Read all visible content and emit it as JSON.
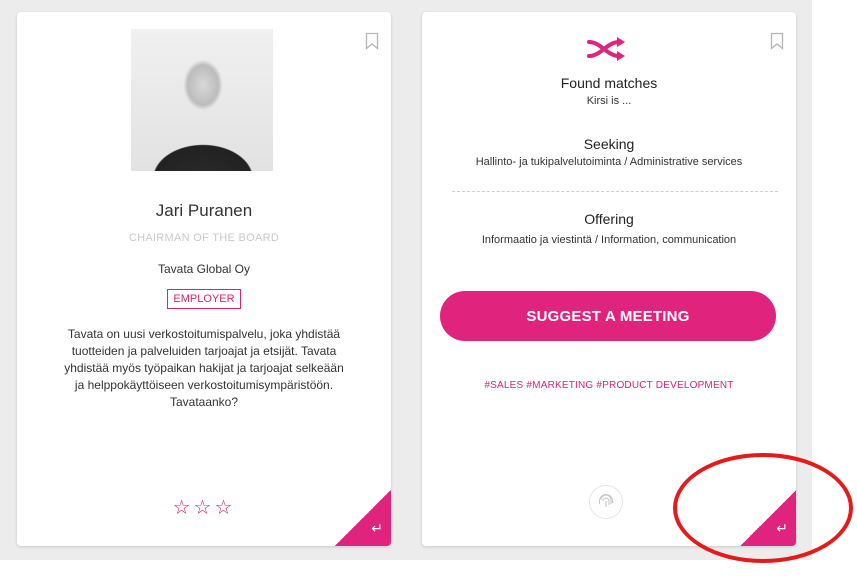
{
  "colors": {
    "accent": "#e0237c",
    "annotation": "#e31b1b"
  },
  "profile_card": {
    "name": "Jari Puranen",
    "title": "CHAIRMAN OF THE BOARD",
    "company": "Tavata Global Oy",
    "role_badge": "EMPLOYER",
    "description": "Tavata on uusi verkostoitumispalvelu, joka yhdistää tuotteiden ja palveluiden tarjoajat ja etsijät. Tavata yhdistää myös työpaikan hakijat ja tarjoajat selkeään ja helppokäyttöiseen verkostoitumisympäristöön. Tavataanko?",
    "stars": "☆☆☆",
    "corner_icon": "reply-arrow-icon",
    "bookmark_icon": "bookmark-icon"
  },
  "match_card": {
    "icon": "shuffle-icon",
    "found_label": "Found matches",
    "found_value": "Kirsi is ...",
    "seeking_label": "Seeking",
    "seeking_value": "Hallinto- ja tukipalvelutoiminta / Administrative services",
    "offering_label": "Offering",
    "offering_value": "Informaatio ja viestintä / Information, communication",
    "button_label": "SUGGEST A MEETING",
    "tags": "#SALES #MARKETING #PRODUCT DEVELOPMENT",
    "bottom_icon": "fingerprint-icon",
    "corner_icon": "reply-arrow-icon",
    "bookmark_icon": "bookmark-icon"
  }
}
